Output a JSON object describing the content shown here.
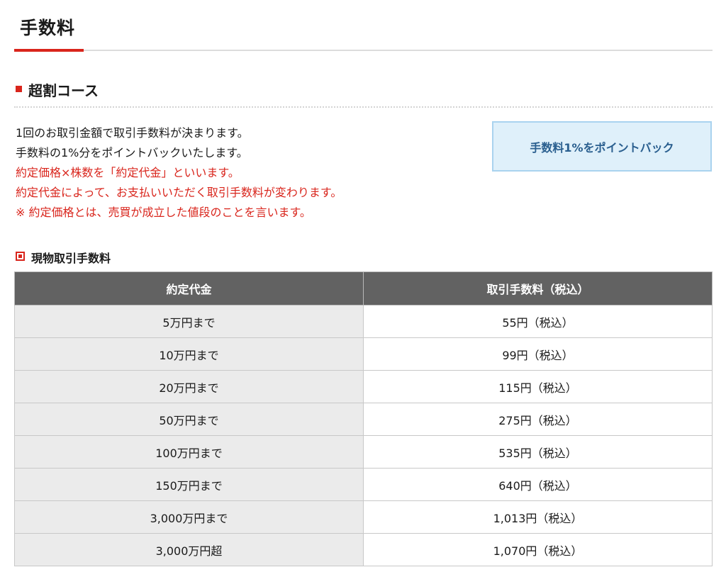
{
  "page": {
    "title": "手数料"
  },
  "course": {
    "title": "超割コース",
    "description": [
      {
        "text": "1回のお取引金額で取引手数料が決まります。",
        "highlight": false
      },
      {
        "text": "手数料の1%分をポイントバックいたします。",
        "highlight": false
      },
      {
        "text": "約定価格×株数を「約定代金」といいます。",
        "highlight": true
      },
      {
        "text": "約定代金によって、お支払いいただく取引手数料が変わります。",
        "highlight": true
      },
      {
        "text": "※ 約定価格とは、売買が成立した値段のことを言います。",
        "highlight": true
      }
    ],
    "point_back_label": "手数料1%をポイントバック"
  },
  "fee_table": {
    "title": "現物取引手数料",
    "headers": [
      "約定代金",
      "取引手数料（税込）"
    ],
    "rows": [
      {
        "amount": "5万円まで",
        "fee": "55円（税込）"
      },
      {
        "amount": "10万円まで",
        "fee": "99円（税込）"
      },
      {
        "amount": "20万円まで",
        "fee": "115円（税込）"
      },
      {
        "amount": "50万円まで",
        "fee": "275円（税込）"
      },
      {
        "amount": "100万円まで",
        "fee": "535円（税込）"
      },
      {
        "amount": "150万円まで",
        "fee": "640円（税込）"
      },
      {
        "amount": "3,000万円まで",
        "fee": "1,013円（税込）"
      },
      {
        "amount": "3,000万円超",
        "fee": "1,070円（税込）"
      }
    ]
  },
  "colors": {
    "accent": "#d9251c",
    "header_bg": "#626262",
    "amount_cell_bg": "#ebebeb",
    "point_box_bg": "#dff0fa",
    "point_box_border": "#a9d3ef",
    "point_box_text": "#2a5f8f"
  }
}
